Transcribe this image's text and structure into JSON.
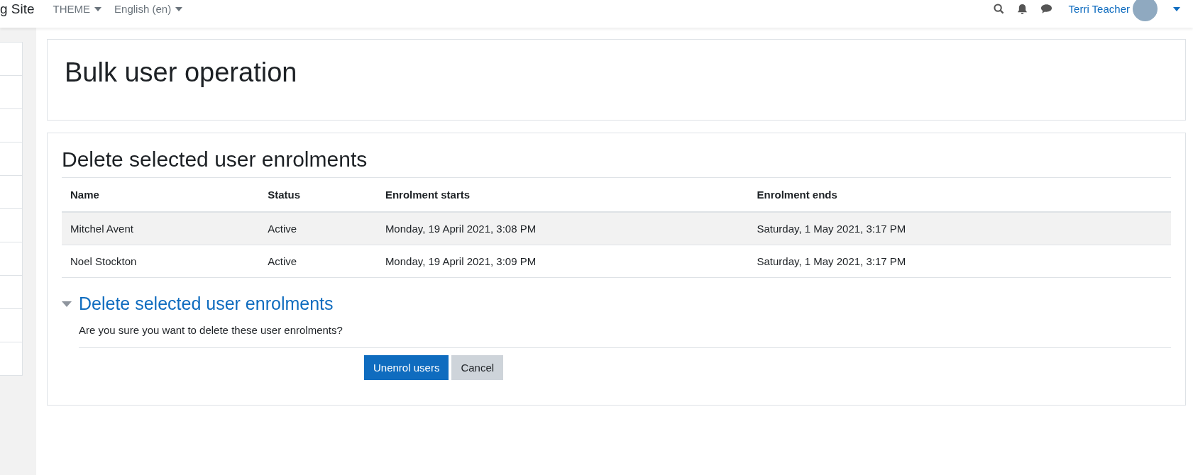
{
  "navbar": {
    "site_name": "g Site",
    "menus": [
      {
        "label": "THEME"
      },
      {
        "label": "English (en)"
      }
    ],
    "user": {
      "name": "Terri Teacher"
    }
  },
  "page_header": {
    "title": "Bulk user operation"
  },
  "section": {
    "title": "Delete selected user enrolments",
    "table": {
      "columns": [
        "Name",
        "Status",
        "Enrolment starts",
        "Enrolment ends"
      ],
      "rows": [
        {
          "cells": [
            "Mitchel Avent",
            "Active",
            "Monday, 19 April 2021, 3:08 PM",
            "Saturday, 1 May 2021, 3:17 PM"
          ],
          "highlighted": true
        },
        {
          "cells": [
            "Noel Stockton",
            "Active",
            "Monday, 19 April 2021, 3:09 PM",
            "Saturday, 1 May 2021, 3:17 PM"
          ],
          "highlighted": false
        }
      ]
    },
    "fieldset": {
      "legend": "Delete selected user enrolments",
      "expanded": true,
      "message": "Are you sure you want to delete these user enrolments?",
      "buttons": [
        {
          "label": "Unenrol users",
          "kind": "primary"
        },
        {
          "label": "Cancel",
          "kind": "secondary"
        }
      ]
    }
  }
}
